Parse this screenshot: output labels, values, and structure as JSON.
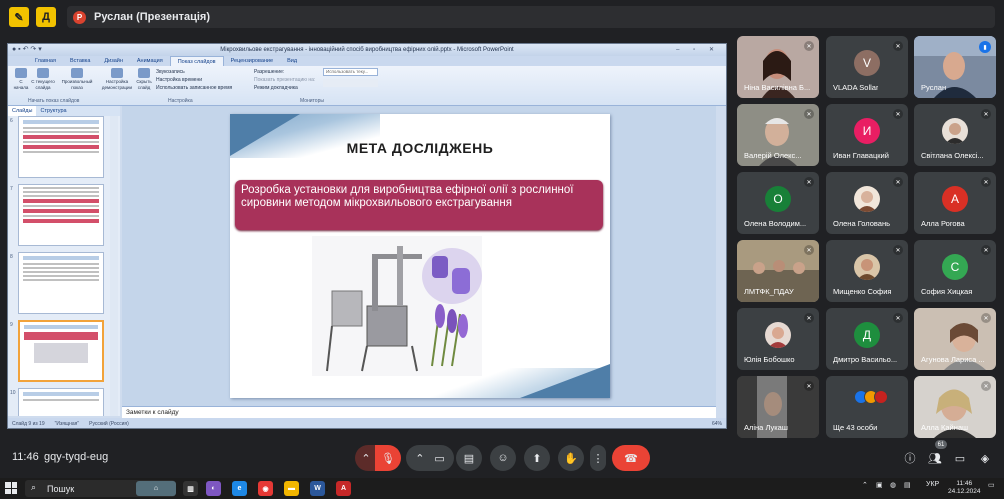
{
  "topbar": {
    "presenter_initial": "Р",
    "presenter_label": "Руслан (Презентація)"
  },
  "ppt": {
    "window_title": "Мікрохвильове екстрагування - інноваційний спосіб виробництва ефірних олій.pptx - Microsoft PowerPoint",
    "tabs": [
      "Главная",
      "Вставка",
      "Дизайн",
      "Анимация",
      "Показ слайдов",
      "Рецензирование",
      "Вид"
    ],
    "active_tab": "Показ слайдов",
    "ribbon": {
      "btn_from_start": "С начала",
      "btn_from_current": "С текущего слайда",
      "btn_custom_show": "Произвольный показ",
      "group_start": "Начать показ слайдов",
      "btn_setup": "Настройка демонстрации",
      "btn_hide": "Скрыть слайд",
      "opt_rehearse": "Звукозапись",
      "opt_timings": "Настройка времени",
      "opt_use_timings": "Использовать записанное время",
      "group_setup": "Настройка",
      "opt_resolution": "Разрешение:",
      "opt_show_on": "Показать презентацию на:",
      "opt_presenter": "Режим докладчика",
      "combo_value": "Использовать теку...",
      "group_monitors": "Мониторы"
    },
    "panel_tabs": [
      "Слайды",
      "Структура"
    ],
    "thumb_numbers": [
      "6",
      "7",
      "8",
      "9",
      "10"
    ],
    "slide": {
      "title": "МЕТА ДОСЛІДЖЕНЬ",
      "text": "Розробка установки для виробництва  ефірної олії з рослинної сировини методом мікрохвильового екстрагування"
    },
    "notes_label": "Заметки к слайду",
    "status": {
      "slide_of": "Слайд 9 из 19",
      "theme": "\"Изящная\"",
      "language": "Русский (Россия)",
      "zoom": "64%"
    }
  },
  "participants": [
    {
      "name": "Ніна Василівна Б...",
      "type": "photo",
      "muted": true
    },
    {
      "name": "VLADA Sollar",
      "type": "letter",
      "letter": "V",
      "color": "#8d6e63",
      "muted": true
    },
    {
      "name": "Руслан",
      "type": "photo",
      "muted": false,
      "speaking": true
    },
    {
      "name": "Валерій Олекс...",
      "type": "photo",
      "muted": true
    },
    {
      "name": "Иван Главацкий",
      "type": "letter",
      "letter": "И",
      "color": "#e91e63",
      "muted": true
    },
    {
      "name": "Світлана Олексі...",
      "type": "avatar",
      "muted": true
    },
    {
      "name": "Олена Володим...",
      "type": "letter",
      "letter": "О",
      "color": "#188038",
      "muted": true
    },
    {
      "name": "Олена Головань",
      "type": "avatar",
      "muted": true
    },
    {
      "name": "Алла Рогова",
      "type": "letter",
      "letter": "А",
      "color": "#d93025",
      "muted": true
    },
    {
      "name": "ЛМТФК_ПДАУ",
      "type": "photo",
      "muted": true
    },
    {
      "name": "Мищенко София",
      "type": "avatar",
      "muted": true
    },
    {
      "name": "София Хицкая",
      "type": "letter",
      "letter": "С",
      "color": "#34a853",
      "muted": true
    },
    {
      "name": "Юлія Бобошко",
      "type": "avatar",
      "muted": true
    },
    {
      "name": "Дмитро Васильо...",
      "type": "letter",
      "letter": "Д",
      "color": "#1e8e3e",
      "muted": true
    },
    {
      "name": "Агунова Лариса ...",
      "type": "photo",
      "muted": true
    },
    {
      "name": "Аліна Лукаш",
      "type": "photo",
      "muted": true
    },
    {
      "name": "Ще 43 особи",
      "type": "more",
      "muted": false
    },
    {
      "name": "Алла Кайнаш",
      "type": "photo",
      "muted": true
    }
  ],
  "meeting": {
    "time": "11:46",
    "code": "gqy-tyqd-eug",
    "participants_badge": "61"
  },
  "taskbar": {
    "search_placeholder": "Пошук",
    "lang": "УКР",
    "time": "11:46",
    "date": "24.12.2024"
  }
}
